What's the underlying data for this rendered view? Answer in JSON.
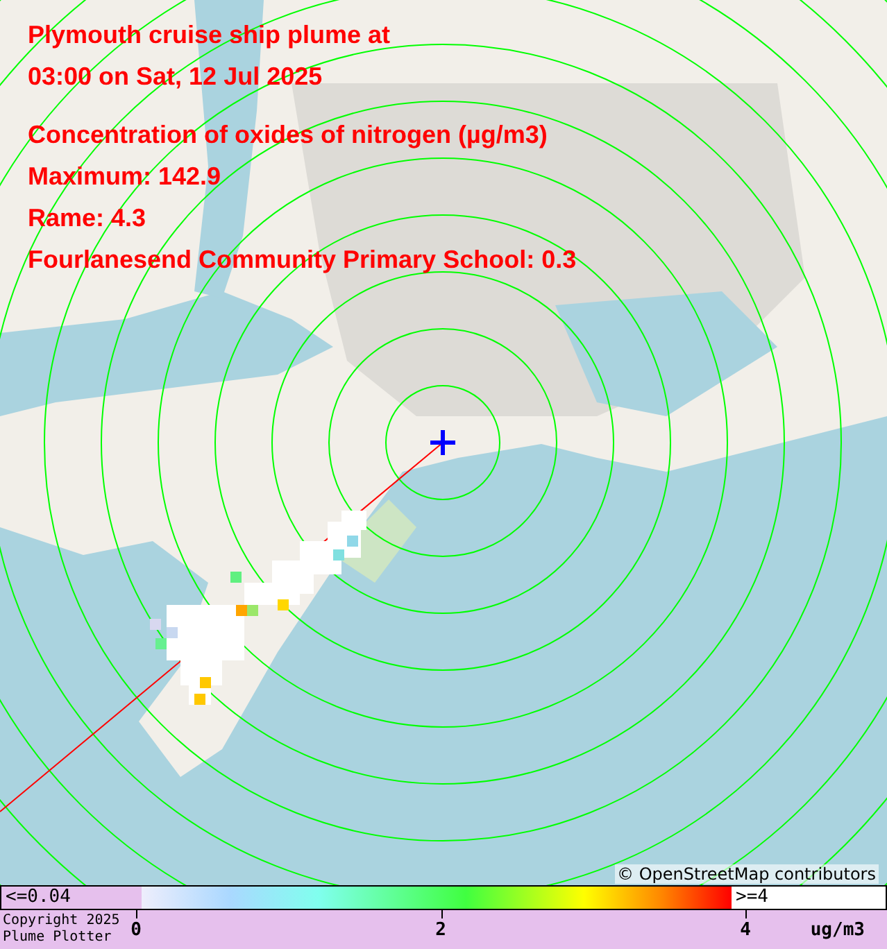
{
  "title_lines": [
    "Plymouth cruise ship plume at",
    "03:00 on Sat, 12 Jul 2025"
  ],
  "stats_lines": [
    "Concentration of oxides of nitrogen (µg/m3)",
    "Maximum: 142.9",
    "Rame: 4.3",
    "Fourlanesend Community Primary School: 0.3"
  ],
  "attribution": "© OpenStreetMap contributors",
  "legend": {
    "low_label": "<=0.04",
    "high_label": ">=4",
    "ticks": [
      "0",
      "2",
      "4"
    ],
    "unit": "ug/m3"
  },
  "copyright": [
    "Copyright 2025",
    "Plume Plotter"
  ]
}
